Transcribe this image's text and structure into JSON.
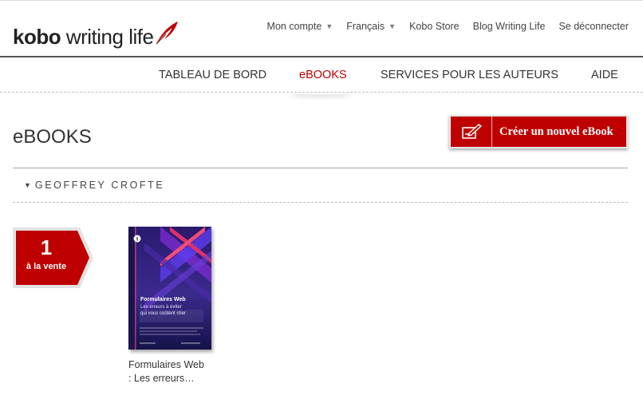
{
  "brand": {
    "logo_bold": "kobo",
    "logo_light": " writing life",
    "accent_color": "#bf0000"
  },
  "header_links": [
    {
      "label": "Mon compte",
      "dropdown": true
    },
    {
      "label": "Français",
      "dropdown": true
    },
    {
      "label": "Kobo Store",
      "dropdown": false
    },
    {
      "label": "Blog Writing Life",
      "dropdown": false
    },
    {
      "label": "Se déconnecter",
      "dropdown": false
    }
  ],
  "nav": {
    "dashboard": "TABLEAU DE BORD",
    "ebooks": "eBOOKS",
    "services": "SERVICES POUR LES AUTEURS",
    "help": "AIDE",
    "active": "ebooks"
  },
  "page": {
    "title": "eBOOKS",
    "create_button": "Créer un nouvel eBook",
    "create_icon": "pen-paper-icon"
  },
  "author": {
    "name": "GEOFFREY CROFTE"
  },
  "sales_badge": {
    "count": "1",
    "label": "à la vente"
  },
  "books": [
    {
      "title": "Formulaires Web : Les erreurs…",
      "cover": {
        "title": "Formulaires Web",
        "subtitle_line1": "Les erreurs à éviter",
        "subtitle_line2": "qui vous coûtent cher",
        "badge_icon": "info-icon"
      }
    }
  ]
}
